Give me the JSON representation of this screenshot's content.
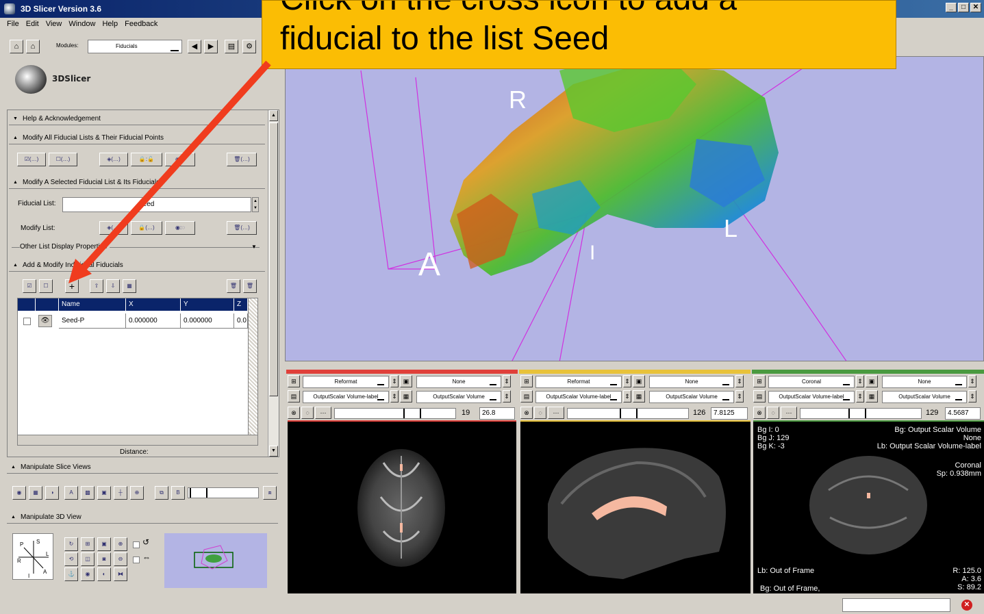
{
  "window": {
    "title": "3D Slicer Version 3.6"
  },
  "menu": [
    "File",
    "Edit",
    "View",
    "Window",
    "Help",
    "Feedback"
  ],
  "toolbar": {
    "modules_label": "Modules:",
    "module_value": "Fiducials"
  },
  "logo_text": "3DSlicer",
  "sections": {
    "help": "Help & Acknowledgement",
    "modify_all": "Modify All Fiducial Lists & Their Fiducial Points",
    "modify_selected": "Modify A Selected Fiducial List & Its Fiducials",
    "fiducial_list_label": "Fiducial List:",
    "fiducial_list_value": "Seed",
    "modify_list_label": "Modify List:",
    "other_props": "Other List Display Properties",
    "add_modify": "Add & Modify Individual Fiducials",
    "distance_label": "Distance:",
    "manipulate_slice": "Manipulate Slice Views",
    "manipulate_3d": "Manipulate 3D View"
  },
  "table": {
    "headers": [
      "Name",
      "X",
      "Y",
      "Z"
    ],
    "rows": [
      {
        "name": "Seed-P",
        "x": "0.000000",
        "y": "0.000000",
        "z": "0.0"
      }
    ]
  },
  "view3d": {
    "labels": {
      "r": "R",
      "l": "L",
      "a": "A",
      "i": "I"
    }
  },
  "slices": [
    {
      "orientation": "Reformat",
      "fg": "None",
      "label": "OutputScalar Volume-label",
      "bg": "OutputScalar Volume",
      "index": "19",
      "offset": "26.8",
      "color": "#e0403a"
    },
    {
      "orientation": "Reformat",
      "fg": "None",
      "label": "OutputScalar Volume-label",
      "bg": "OutputScalar Volume",
      "index": "126",
      "offset": "7.8125",
      "color": "#e8c23a"
    },
    {
      "orientation": "Coronal",
      "fg": "None",
      "label": "OutputScalar Volume-label",
      "bg": "OutputScalar Volume",
      "index": "129",
      "offset": "4.5687",
      "color": "#4a9a40"
    }
  ],
  "coronal_overlay": {
    "bg_i": "Bg I: 0",
    "bg_j": "Bg J: 129",
    "bg_k": "Bg K: -3",
    "bg_name": "Bg: Output Scalar Volume",
    "none": "None",
    "lb_name": "Lb: Output Scalar Volume-label",
    "orient": "Coronal",
    "spacing": "Sp: 0.938mm",
    "lb_frame": "Lb: Out of Frame",
    "bg_frame": "Bg: Out of Frame,",
    "r": "R: 125.0",
    "a": "A: 3.6",
    "s": "S: 89.2"
  },
  "callout": {
    "line1": "Click on the cross icon to add a",
    "line2": "fiducial to the list Seed"
  },
  "colors": {
    "accent_red": "#f03c1e",
    "callout_bg": "#fbbd04",
    "view_bg": "#b3b4e4"
  }
}
